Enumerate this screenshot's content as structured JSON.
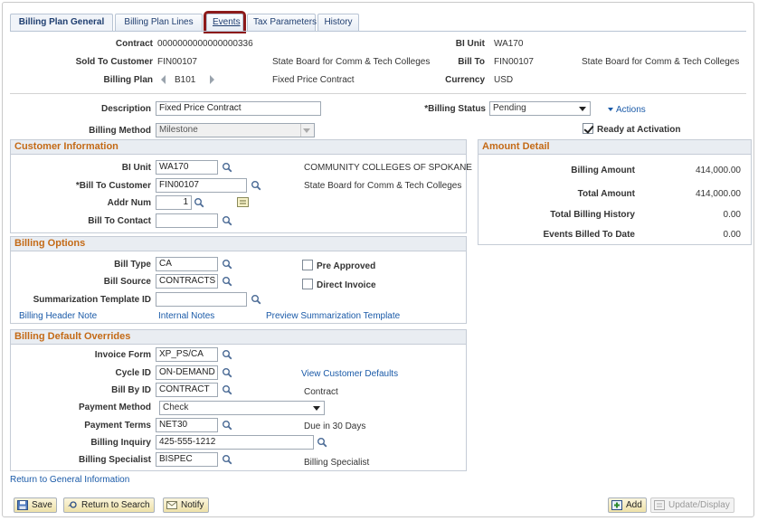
{
  "tabs": [
    {
      "label": "Billing Plan General",
      "accel": ""
    },
    {
      "label": "Billing Plan Lines",
      "accel": "L"
    },
    {
      "label": "Events",
      "accel": "E"
    },
    {
      "label": "Tax Parameters",
      "accel": "T"
    },
    {
      "label": "History",
      "accel": ""
    }
  ],
  "header": {
    "contract_label": "Contract",
    "contract_value": "0000000000000000336",
    "bi_unit_label": "BI Unit",
    "bi_unit_value": "WA170",
    "sold_to_label": "Sold To Customer",
    "sold_to_value": "FIN00107",
    "sold_to_name": "State Board for Comm & Tech Colleges",
    "bill_to_label": "Bill To",
    "bill_to_value": "FIN00107",
    "bill_to_name": "State Board for Comm & Tech Colleges",
    "billing_plan_label": "Billing Plan",
    "billing_plan_value": "B101",
    "billing_plan_desc": "Fixed Price Contract",
    "currency_label": "Currency",
    "currency_value": "USD"
  },
  "general": {
    "description_label": "Description",
    "description_value": "Fixed Price Contract",
    "billing_status_label": "*Billing Status",
    "billing_status_value": "Pending",
    "actions_label": "Actions",
    "billing_method_label": "Billing Method",
    "billing_method_value": "Milestone",
    "ready_label": "Ready at Activation"
  },
  "customer_info": {
    "title": "Customer Information",
    "bi_unit_label": "BI Unit",
    "bi_unit_value": "WA170",
    "bi_unit_desc": "COMMUNITY COLLEGES OF SPOKANE",
    "bill_to_label": "*Bill To Customer",
    "bill_to_value": "FIN00107",
    "bill_to_desc": "State Board for Comm & Tech Colleges",
    "addr_label": "Addr Num",
    "addr_value": "1",
    "contact_label": "Bill To Contact",
    "contact_value": ""
  },
  "amount_detail": {
    "title": "Amount Detail",
    "rows": [
      {
        "label": "Billing Amount",
        "value": "414,000.00"
      },
      {
        "label": "Total Amount",
        "value": "414,000.00"
      },
      {
        "label": "Total Billing History",
        "value": "0.00"
      },
      {
        "label": "Events Billed To Date",
        "value": "0.00"
      }
    ]
  },
  "billing_options": {
    "title": "Billing Options",
    "bill_type_label": "Bill Type",
    "bill_type_value": "CA",
    "bill_source_label": "Bill Source",
    "bill_source_value": "CONTRACTS",
    "summ_label": "Summarization Template ID",
    "summ_value": "",
    "pre_approved_label": "Pre Approved",
    "direct_invoice_label": "Direct Invoice",
    "header_note_link": "Billing Header Note",
    "internal_notes_link": "Internal Notes",
    "preview_link": "Preview Summarization Template"
  },
  "overrides": {
    "title": "Billing Default Overrides",
    "invoice_form_label": "Invoice Form",
    "invoice_form_value": "XP_PS/CA",
    "cycle_label": "Cycle ID",
    "cycle_value": "ON-DEMAND",
    "view_defaults_link": "View Customer Defaults",
    "bill_by_label": "Bill By ID",
    "bill_by_value": "CONTRACT",
    "bill_by_desc": "Contract",
    "payment_method_label": "Payment Method",
    "payment_method_value": "Check",
    "payment_terms_label": "Payment Terms",
    "payment_terms_value": "NET30",
    "payment_terms_desc": "Due in 30 Days",
    "inquiry_label": "Billing Inquiry",
    "inquiry_value": "425-555-1212",
    "specialist_label": "Billing Specialist",
    "specialist_value": "BISPEC",
    "specialist_desc": "Billing Specialist"
  },
  "return_link": "Return to General Information",
  "toolbar": {
    "save": "Save",
    "return_search": "Return to Search",
    "notify": "Notify",
    "add": "Add",
    "update_display": "Update/Display"
  },
  "colors": {
    "section_title": "#c46a16",
    "link": "#1a5aa8",
    "highlight": "#8c1a1a"
  }
}
